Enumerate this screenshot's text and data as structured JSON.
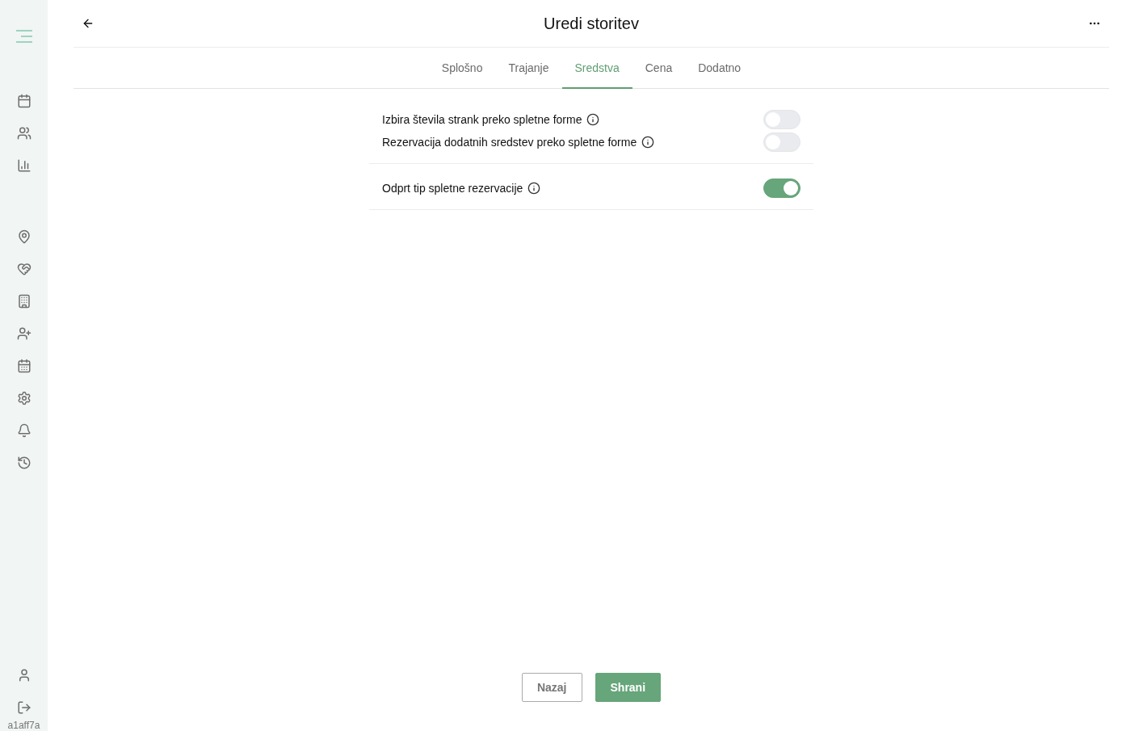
{
  "sidebar": {
    "version": "a1aff7a"
  },
  "header": {
    "title": "Uredi storitev"
  },
  "tabs": [
    {
      "label": "Splošno",
      "selected": false
    },
    {
      "label": "Trajanje",
      "selected": false
    },
    {
      "label": "Sredstva",
      "selected": true
    },
    {
      "label": "Cena",
      "selected": false
    },
    {
      "label": "Dodatno",
      "selected": false
    }
  ],
  "sections": [
    {
      "rows": [
        {
          "label": "Izbira števila strank preko spletne forme",
          "on": false
        },
        {
          "label": "Rezervacija dodatnih sredstev preko spletne forme",
          "on": false
        }
      ]
    },
    {
      "rows": [
        {
          "label": "Odprt tip spletne rezervacije",
          "on": true
        }
      ]
    }
  ],
  "buttons": {
    "back": "Nazaj",
    "save": "Shrani"
  }
}
